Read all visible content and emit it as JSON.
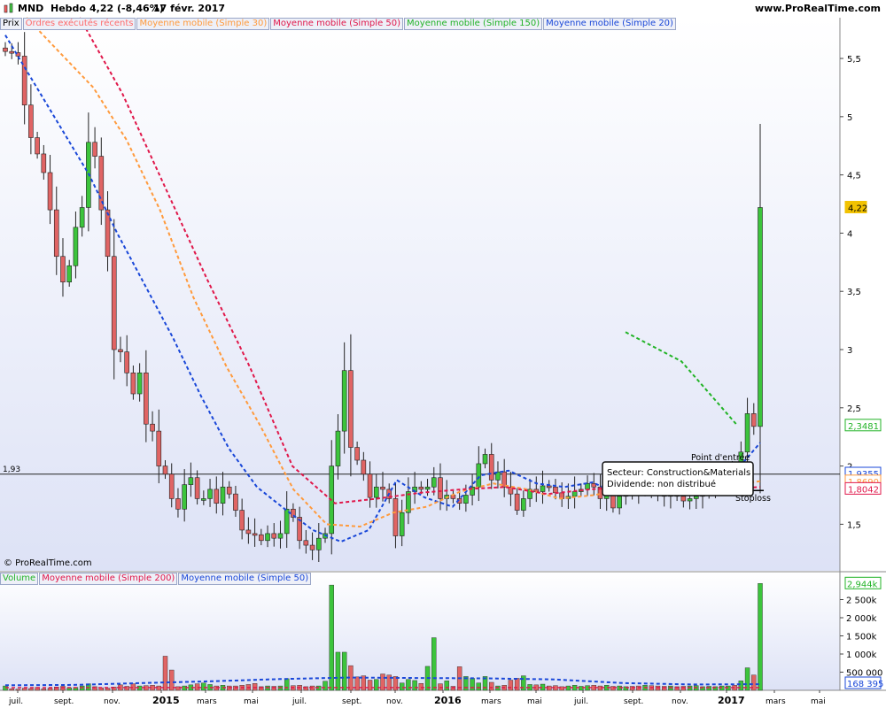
{
  "header": {
    "symbol": "MND",
    "period": "Hebdo",
    "price": "4,22 (-8,46%)",
    "date": "17 févr. 2017",
    "site": "www.ProRealTime.com"
  },
  "price_legend": {
    "items": [
      {
        "label": "Prix",
        "color": "#000000"
      },
      {
        "label": "Ordres exécutés récents",
        "color": "#ff6a6a"
      },
      {
        "label": "Moyenne mobile (Simple 30)",
        "color": "#ff9a3c"
      },
      {
        "label": "Moyenne mobile (Simple 50)",
        "color": "#e0174a"
      },
      {
        "label": "Moyenne mobile (Simple 150)",
        "color": "#21b326"
      },
      {
        "label": "Moyenne mobile (Simple 20)",
        "color": "#1947d8"
      }
    ]
  },
  "volume_legend": {
    "items": [
      {
        "label": "Volume",
        "color": "#21b326"
      },
      {
        "label": "Moyenne mobile (Simple 200)",
        "color": "#e0174a"
      },
      {
        "label": "Moyenne mobile (Simple 50)",
        "color": "#1947d8"
      }
    ]
  },
  "copyright": "© ProRealTime.com",
  "chart_data": [
    {
      "type": "candlestick",
      "panel": "price",
      "y_ticks": [
        "5,5",
        "5",
        "4,5",
        "4",
        "3,5",
        "3",
        "2,5",
        "2",
        "1,5"
      ],
      "ylim": [
        1.1,
        5.85
      ],
      "x_ticks": [
        "juil.",
        "sept.",
        "nov.",
        "2015",
        "mars",
        "mai",
        "juil.",
        "sept.",
        "nov.",
        "2016",
        "mars",
        "mai",
        "juil.",
        "sept.",
        "nov.",
        "2017",
        "mars",
        "mai"
      ],
      "reference_line": {
        "label": "1,93",
        "value": 1.93
      },
      "price_tags": [
        {
          "label": "4,22",
          "value": 4.22,
          "color": "#f2c200"
        },
        {
          "label": "2,3481",
          "value": 2.348,
          "color": "#21b326"
        },
        {
          "label": "1,9355",
          "value": 1.936,
          "color": "#1947d8"
        },
        {
          "label": "1,8690",
          "value": 1.869,
          "color": "#ff9a3c"
        },
        {
          "label": "1,8042",
          "value": 1.804,
          "color": "#e0174a"
        }
      ],
      "annotations": [
        {
          "text": "Point d'entrée",
          "value": 1.93
        },
        {
          "text": "Stoploss",
          "value": 1.79
        }
      ],
      "info_box": [
        "Secteur: Construction&Materials",
        "Dividende: non distribué"
      ],
      "series": [
        {
          "name": "Prix",
          "values": [
            5.56,
            5.55,
            5.52,
            5.1,
            4.82,
            4.68,
            4.52,
            4.2,
            3.8,
            3.58,
            3.72,
            4.05,
            4.22,
            4.78,
            4.66,
            4.2,
            3.8,
            3.0,
            2.98,
            2.8,
            2.62,
            2.8,
            2.36,
            2.3,
            2.0,
            1.93,
            1.72,
            1.63,
            1.84,
            1.9,
            1.72,
            1.72,
            1.8,
            1.68,
            1.82,
            1.76,
            1.62,
            1.45,
            1.42,
            1.41,
            1.36,
            1.42,
            1.38,
            1.42,
            1.63,
            1.56,
            1.36,
            1.32,
            1.28,
            1.38,
            1.42,
            2.0,
            2.3,
            2.82,
            2.16,
            2.05,
            1.93,
            1.73,
            1.82,
            1.8,
            1.72,
            1.4,
            1.6,
            1.78,
            1.82,
            1.8,
            1.82,
            1.9,
            1.72,
            1.75,
            1.72,
            1.68,
            1.75,
            1.82,
            2.02,
            2.1,
            1.88,
            1.95,
            1.82,
            1.76,
            1.62,
            1.72,
            1.8,
            1.78,
            1.83,
            1.82,
            1.77,
            1.72,
            1.74,
            1.78,
            1.8,
            1.85,
            1.82,
            1.72,
            1.76,
            1.64,
            1.74,
            1.82,
            1.8,
            1.78,
            1.79,
            1.78,
            1.77,
            1.74,
            1.76,
            1.74,
            1.7,
            1.72,
            1.74,
            1.76,
            1.78,
            1.86,
            1.88,
            1.88,
            1.86,
            2.12,
            2.45,
            2.34,
            4.22
          ]
        },
        {
          "name": "Moyenne mobile (Simple 20)",
          "values": [
            5.7,
            5.3,
            4.9,
            4.5,
            4.0,
            3.55,
            3.1,
            2.6,
            2.15,
            1.82,
            1.63,
            1.45,
            1.35,
            1.45,
            1.88,
            1.73,
            1.65,
            1.92,
            1.96,
            1.85,
            1.82,
            1.86,
            1.75,
            1.82,
            1.8,
            1.8,
            1.92,
            2.2
          ]
        },
        {
          "name": "Moyenne mobile (Simple 30)",
          "values": [
            5.85,
            5.55,
            5.25,
            4.8,
            4.2,
            3.45,
            2.85,
            2.35,
            1.8,
            1.5,
            1.48,
            1.6,
            1.65,
            1.78,
            1.85,
            1.8,
            1.72,
            1.75,
            1.8,
            1.81,
            1.8,
            1.83,
            1.87
          ]
        },
        {
          "name": "Moyenne mobile (Simple 50)",
          "values": [
            5.85,
            5.2,
            4.4,
            3.6,
            2.85,
            2.0,
            1.68,
            1.72,
            1.77,
            1.8,
            1.82,
            1.76,
            1.8,
            1.82,
            1.8,
            1.8,
            1.82
          ]
        },
        {
          "name": "Moyenne mobile (Simple 150)",
          "values": [
            3.15,
            2.9,
            2.35
          ]
        }
      ]
    },
    {
      "type": "bar",
      "panel": "volume",
      "y_ticks": [
        "2 500k",
        "2 000k",
        "1 500k",
        "1 000k",
        "500 000"
      ],
      "ylim": [
        0,
        3000000
      ],
      "price_tags": [
        {
          "label": "2,944k",
          "value": 2944000,
          "color": "#21b326"
        },
        {
          "label": "168 395",
          "value": 168395,
          "color": "#1947d8"
        }
      ],
      "series": [
        {
          "name": "Volume",
          "values": [
            120000,
            40000,
            30000,
            60000,
            50000,
            80000,
            40000,
            60000,
            90000,
            110000,
            70000,
            80000,
            120000,
            180000,
            100000,
            70000,
            60000,
            90000,
            150000,
            110000,
            180000,
            120000,
            130000,
            140000,
            120000,
            940000,
            560000,
            100000,
            120000,
            150000,
            180000,
            200000,
            160000,
            120000,
            140000,
            120000,
            120000,
            140000,
            160000,
            190000,
            100000,
            120000,
            110000,
            120000,
            320000,
            130000,
            140000,
            100000,
            120000,
            120000,
            250000,
            2900000,
            1050000,
            1050000,
            680000,
            370000,
            400000,
            280000,
            300000,
            450000,
            420000,
            380000,
            200000,
            300000,
            270000,
            190000,
            660000,
            1450000,
            180000,
            260000,
            110000,
            650000,
            380000,
            330000,
            200000,
            380000,
            220000,
            120000,
            140000,
            280000,
            330000,
            400000,
            160000,
            150000,
            170000,
            120000,
            130000,
            100000,
            120000,
            140000,
            110000,
            130000,
            140000,
            120000,
            140000,
            110000,
            120000,
            100000,
            110000,
            120000,
            140000,
            130000,
            120000,
            110000,
            120000,
            100000,
            110000,
            120000,
            130000,
            100000,
            110000,
            100000,
            120000,
            120000,
            140000,
            260000,
            620000,
            420000,
            2944000
          ]
        },
        {
          "name": "Moyenne mobile (Simple 50)",
          "values": [
            140000,
            150000,
            200000,
            250000,
            310000,
            350000,
            340000,
            330000,
            300000,
            200000,
            160000,
            168000
          ]
        }
      ]
    }
  ]
}
